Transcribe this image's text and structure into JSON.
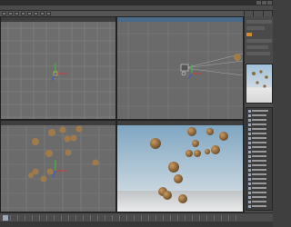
{
  "app": {
    "title": "",
    "menus": [
      "",
      "",
      "",
      "",
      "",
      "",
      "",
      ""
    ]
  },
  "viewports": [
    {
      "name": "top-left",
      "label": "",
      "active": false
    },
    {
      "name": "top-right",
      "label": "",
      "active": true
    },
    {
      "name": "bottom-left",
      "label": "",
      "active": false
    },
    {
      "name": "bottom-right",
      "label": "",
      "active": false
    }
  ],
  "colors": {
    "background": "#3f3f3f",
    "viewport_grey": "#6d6d6d",
    "grid_line": "#8a8a8a",
    "active_header": "#4a6a8a",
    "sphere": "#a07a4a",
    "sky_top": "#8fb0c8",
    "ground": "#d8d8d8"
  },
  "icons": {
    "axis_gizmo": "axis-gizmo-icon",
    "camera": "camera-icon"
  },
  "status": {
    "text": ""
  }
}
